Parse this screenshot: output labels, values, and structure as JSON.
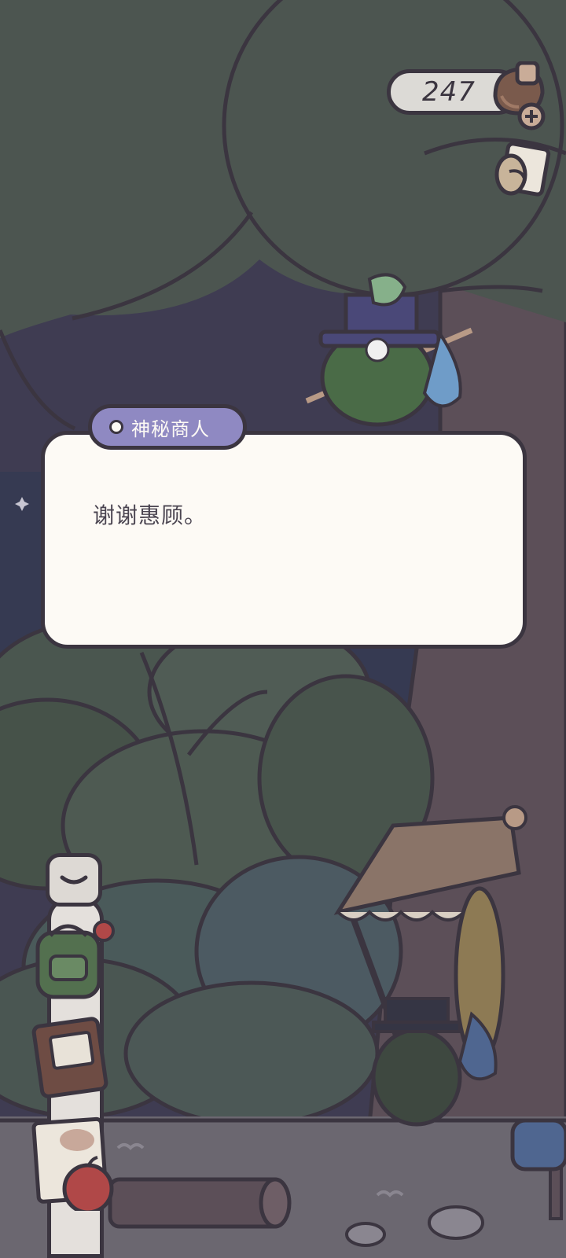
{
  "hud": {
    "clover_count": "247",
    "clover_icon": "clover-pot-icon",
    "add_icon": "plus-icon",
    "letter_icon": "letter-icon"
  },
  "dialog": {
    "speaker": "神秘商人",
    "text": "谢谢惠顾。"
  },
  "side_menu": {
    "collapse_icon": "chevron-down-icon",
    "items": [
      "backpack-icon",
      "journal-icon",
      "album-icon"
    ]
  },
  "colors": {
    "outline": "#3b3540",
    "dialog_bg": "#fdfaf5",
    "speaker_tag": "#8f89c2",
    "tree_canopy": "#4c5550",
    "tree_trunk": "#5c4f58",
    "night_sky": "#3f3c52",
    "ground": "#6b6770"
  }
}
